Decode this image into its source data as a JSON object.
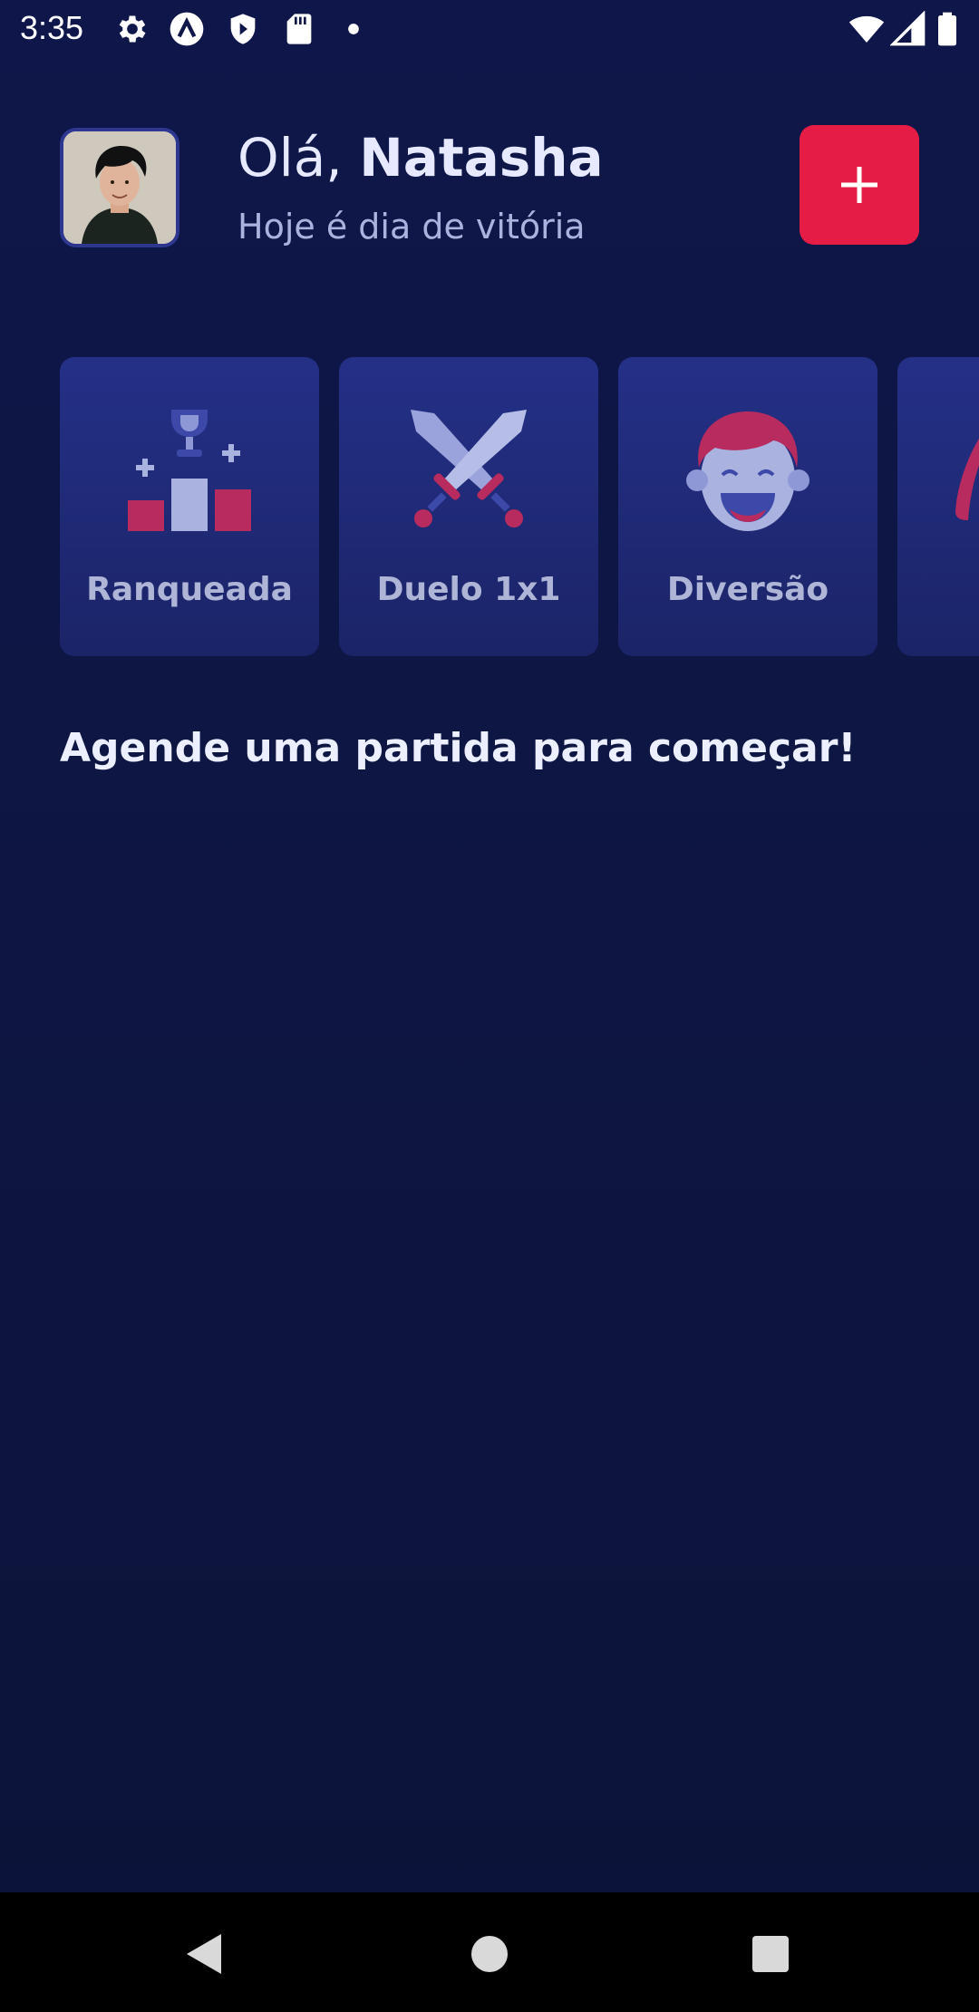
{
  "status_bar": {
    "time": "3:35",
    "left_icons": [
      "settings-icon",
      "app-a-icon",
      "shield-icon",
      "sd-card-icon",
      "dot-icon"
    ],
    "right_icons": [
      "wifi-icon",
      "signal-icon",
      "battery-icon"
    ]
  },
  "header": {
    "greeting": "Olá,",
    "user_name": "Natasha",
    "subtitle": "Hoje é dia de vitória",
    "add_button_icon": "plus-icon"
  },
  "categories": [
    {
      "label": "Ranqueada",
      "icon": "podium-trophy-icon"
    },
    {
      "label": "Duelo 1x1",
      "icon": "crossed-swords-icon"
    },
    {
      "label": "Diversão",
      "icon": "laughing-face-icon"
    },
    {
      "label": "",
      "icon": "partial-card-icon"
    }
  ],
  "main": {
    "empty_message": "Agende uma partida para começar!"
  },
  "nav": {
    "items": [
      "back-icon",
      "home-icon",
      "recents-icon"
    ]
  },
  "colors": {
    "background": "#0f174a",
    "card": "#243087",
    "accent": "#e51c44",
    "icon_light": "#aab2e0",
    "icon_accent": "#b72b5e"
  }
}
